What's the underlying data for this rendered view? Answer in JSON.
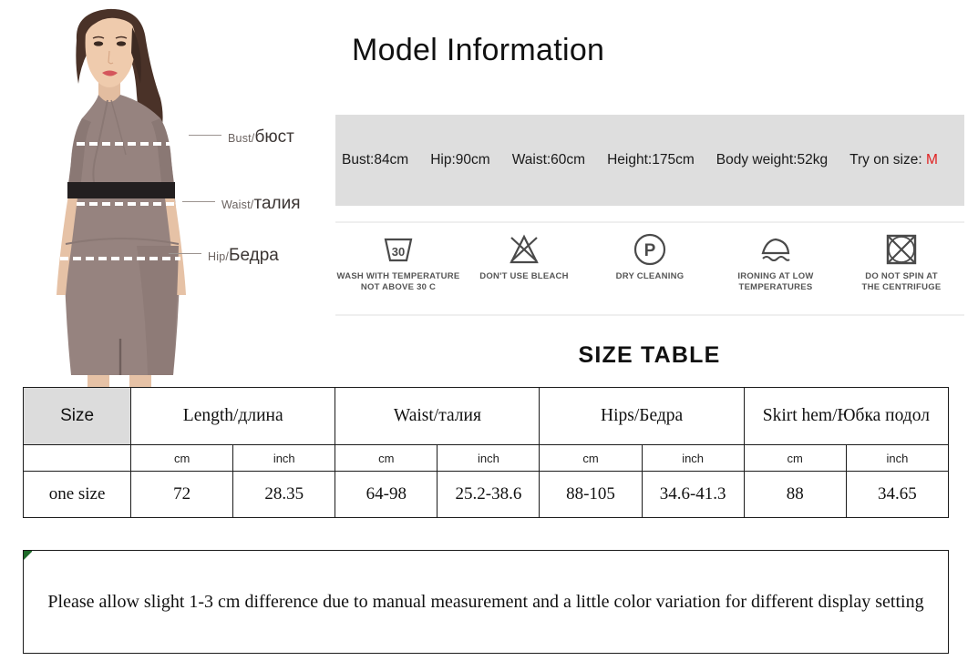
{
  "model_photo": {
    "alt": "female-model-in-taupe-sheath-dress",
    "dress_color": "#96837f",
    "belt_color": "#231f20",
    "skin_color": "#e8c4a8",
    "hair_color": "#4a3228",
    "measurement_labels": [
      {
        "name": "bust",
        "en": "Bust/",
        "ru": "бюст"
      },
      {
        "name": "waist",
        "en": "Waist/",
        "ru": "талия"
      },
      {
        "name": "hip",
        "en": "Hip/",
        "ru": "Бедра"
      }
    ]
  },
  "header": {
    "title": "Model Information"
  },
  "model_stats": {
    "panel_bg": "#dedede",
    "accent_color": "#e02020",
    "items": [
      {
        "name": "bust",
        "text": "Bust:84cm"
      },
      {
        "name": "hip",
        "text": "Hip:90cm"
      },
      {
        "name": "waist",
        "text": "Waist:60cm"
      },
      {
        "name": "height",
        "text": "Height:175cm"
      },
      {
        "name": "body-weight",
        "text": "Body weight:52kg"
      }
    ],
    "try_on_label": "Try on size: ",
    "try_on_value": "M"
  },
  "care_instructions": [
    {
      "icon": "wash-tub-30-icon",
      "caption": "WASH WITH TEMPERATURE\nNOT ABOVE 30 C",
      "line1": "WASH WITH TEMPERATURE",
      "line2": "NOT ABOVE 30 C",
      "tub_number": "30"
    },
    {
      "icon": "no-bleach-triangle-icon",
      "caption": "DON'T USE BLEACH",
      "line1": "DON'T USE BLEACH",
      "line2": ""
    },
    {
      "icon": "dry-clean-p-circle-icon",
      "caption": "DRY CLEANING",
      "line1": "DRY CLEANING",
      "line2": "",
      "letter": "P"
    },
    {
      "icon": "iron-low-temp-icon",
      "caption": "IRONING AT LOW\nTEMPERATURES",
      "line1": "IRONING AT LOW",
      "line2": "TEMPERATURES"
    },
    {
      "icon": "no-tumble-spin-icon",
      "caption": "DO NOT SPIN AT\nTHE CENTRIFUGE",
      "line1": "DO NOT SPIN AT",
      "line2": "THE CENTRIFUGE"
    }
  ],
  "size_table": {
    "title": "SIZE TABLE",
    "size_header": "Size",
    "group_headers": [
      "Length/длина",
      "Waist/талия",
      "Hips/Бедра",
      "Skirt hem/Юбка подол"
    ],
    "unit_row": [
      "cm",
      "inch",
      "cm",
      "inch",
      "cm",
      "inch",
      "cm",
      "inch"
    ],
    "rows": [
      {
        "size": "one size",
        "length_cm": "72",
        "length_inch": "28.35",
        "waist_cm": "64-98",
        "waist_inch": "25.2-38.6",
        "hips_cm": "88-105",
        "hips_inch": "34.6-41.3",
        "skirt_hem_cm": "88",
        "skirt_hem_inch": "34.65"
      }
    ]
  },
  "footer": {
    "note": "Please allow slight 1-3 cm difference due to manual measurement and a little color variation for different display setting",
    "accent_color": "#1f6b2a"
  }
}
